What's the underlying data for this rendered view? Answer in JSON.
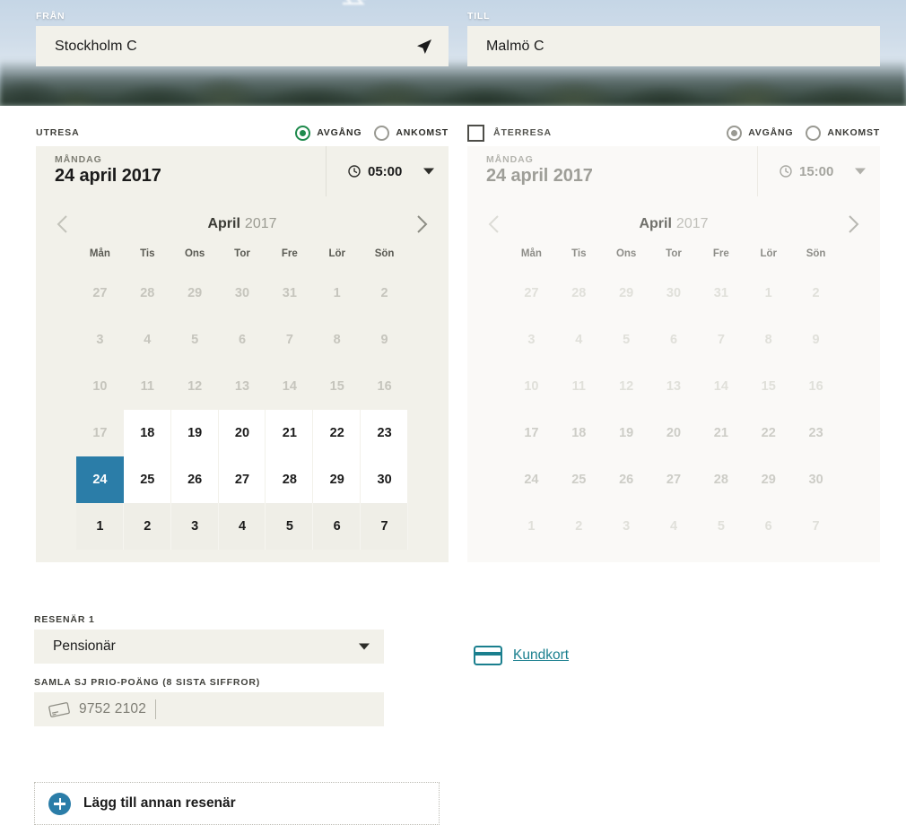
{
  "hero": {
    "from_label": "FRÅN",
    "from_value": "Stockholm C",
    "to_label": "TILL",
    "to_value": "Malmö C",
    "locate_icon": "navigate-arrow-icon"
  },
  "outbound": {
    "title": "UTRESA",
    "radio_departure": "AVGÅNG",
    "radio_arrival": "ANKOMST",
    "selected_radio": "AVGÅNG",
    "weekday": "MÅNDAG",
    "date": "24 april 2017",
    "time": "05:00",
    "calendar": {
      "month": "April",
      "year": "2017",
      "dow": [
        "Mån",
        "Tis",
        "Ons",
        "Tor",
        "Fre",
        "Lör",
        "Sön"
      ],
      "weeks": [
        [
          {
            "d": "27",
            "state": "muted"
          },
          {
            "d": "28",
            "state": "muted"
          },
          {
            "d": "29",
            "state": "muted"
          },
          {
            "d": "30",
            "state": "muted"
          },
          {
            "d": "31",
            "state": "muted"
          },
          {
            "d": "1",
            "state": "muted"
          },
          {
            "d": "2",
            "state": "muted"
          }
        ],
        [
          {
            "d": "3",
            "state": "muted"
          },
          {
            "d": "4",
            "state": "muted"
          },
          {
            "d": "5",
            "state": "muted"
          },
          {
            "d": "6",
            "state": "muted"
          },
          {
            "d": "7",
            "state": "muted"
          },
          {
            "d": "8",
            "state": "muted"
          },
          {
            "d": "9",
            "state": "muted"
          }
        ],
        [
          {
            "d": "10",
            "state": "muted"
          },
          {
            "d": "11",
            "state": "muted"
          },
          {
            "d": "12",
            "state": "muted"
          },
          {
            "d": "13",
            "state": "muted"
          },
          {
            "d": "14",
            "state": "muted"
          },
          {
            "d": "15",
            "state": "muted"
          },
          {
            "d": "16",
            "state": "muted"
          }
        ],
        [
          {
            "d": "17",
            "state": "muted"
          },
          {
            "d": "18",
            "state": "enabled"
          },
          {
            "d": "19",
            "state": "enabled"
          },
          {
            "d": "20",
            "state": "enabled"
          },
          {
            "d": "21",
            "state": "enabled"
          },
          {
            "d": "22",
            "state": "enabled"
          },
          {
            "d": "23",
            "state": "enabled"
          }
        ],
        [
          {
            "d": "24",
            "state": "selected"
          },
          {
            "d": "25",
            "state": "enabled"
          },
          {
            "d": "26",
            "state": "enabled"
          },
          {
            "d": "27",
            "state": "enabled"
          },
          {
            "d": "28",
            "state": "enabled"
          },
          {
            "d": "29",
            "state": "enabled"
          },
          {
            "d": "30",
            "state": "enabled"
          }
        ],
        [
          {
            "d": "1",
            "state": "nextmonth"
          },
          {
            "d": "2",
            "state": "nextmonth"
          },
          {
            "d": "3",
            "state": "nextmonth"
          },
          {
            "d": "4",
            "state": "nextmonth"
          },
          {
            "d": "5",
            "state": "nextmonth"
          },
          {
            "d": "6",
            "state": "nextmonth"
          },
          {
            "d": "7",
            "state": "nextmonth"
          }
        ]
      ]
    }
  },
  "return": {
    "title": "ÅTERRESA",
    "checked": false,
    "radio_departure": "AVGÅNG",
    "radio_arrival": "ANKOMST",
    "selected_radio": "AVGÅNG",
    "weekday": "MÅNDAG",
    "date": "24 april 2017",
    "time": "15:00",
    "calendar": {
      "month": "April",
      "year": "2017",
      "dow": [
        "Mån",
        "Tis",
        "Ons",
        "Tor",
        "Fre",
        "Lör",
        "Sön"
      ],
      "weeks": [
        [
          {
            "d": "27",
            "state": "muted"
          },
          {
            "d": "28",
            "state": "muted"
          },
          {
            "d": "29",
            "state": "muted"
          },
          {
            "d": "30",
            "state": "muted"
          },
          {
            "d": "31",
            "state": "muted"
          },
          {
            "d": "1",
            "state": "muted"
          },
          {
            "d": "2",
            "state": "muted"
          }
        ],
        [
          {
            "d": "3",
            "state": "muted"
          },
          {
            "d": "4",
            "state": "muted"
          },
          {
            "d": "5",
            "state": "muted"
          },
          {
            "d": "6",
            "state": "muted"
          },
          {
            "d": "7",
            "state": "muted"
          },
          {
            "d": "8",
            "state": "muted"
          },
          {
            "d": "9",
            "state": "muted"
          }
        ],
        [
          {
            "d": "10",
            "state": "muted"
          },
          {
            "d": "11",
            "state": "muted"
          },
          {
            "d": "12",
            "state": "muted"
          },
          {
            "d": "13",
            "state": "muted"
          },
          {
            "d": "14",
            "state": "muted"
          },
          {
            "d": "15",
            "state": "muted"
          },
          {
            "d": "16",
            "state": "muted"
          }
        ],
        [
          {
            "d": "17",
            "state": "plain"
          },
          {
            "d": "18",
            "state": "plain"
          },
          {
            "d": "19",
            "state": "plain"
          },
          {
            "d": "20",
            "state": "plain"
          },
          {
            "d": "21",
            "state": "plain"
          },
          {
            "d": "22",
            "state": "plain"
          },
          {
            "d": "23",
            "state": "plain"
          }
        ],
        [
          {
            "d": "24",
            "state": "plain"
          },
          {
            "d": "25",
            "state": "plain"
          },
          {
            "d": "26",
            "state": "plain"
          },
          {
            "d": "27",
            "state": "plain"
          },
          {
            "d": "28",
            "state": "plain"
          },
          {
            "d": "29",
            "state": "plain"
          },
          {
            "d": "30",
            "state": "plain"
          }
        ],
        [
          {
            "d": "1",
            "state": "muted"
          },
          {
            "d": "2",
            "state": "muted"
          },
          {
            "d": "3",
            "state": "muted"
          },
          {
            "d": "4",
            "state": "muted"
          },
          {
            "d": "5",
            "state": "muted"
          },
          {
            "d": "6",
            "state": "muted"
          },
          {
            "d": "7",
            "state": "muted"
          }
        ]
      ]
    }
  },
  "traveller": {
    "label": "RESENÄR 1",
    "type_value": "Pensionär",
    "prio_label": "SAMLA SJ PRIO-POÄNG (8 SISTA SIFFROR)",
    "prio_value": "9752 2102",
    "prio_icon": "credit-card-icon",
    "add_label": "Lägg till annan resenär"
  },
  "kundkort": {
    "label": "Kundkort",
    "icon": "card-icon"
  },
  "colors": {
    "selected_day": "#2b7da8",
    "radio_active": "#1f8a4c",
    "link_teal": "#1a7f8e",
    "panel_cream": "#f2f1ea",
    "panel_light": "#faf9f7"
  }
}
